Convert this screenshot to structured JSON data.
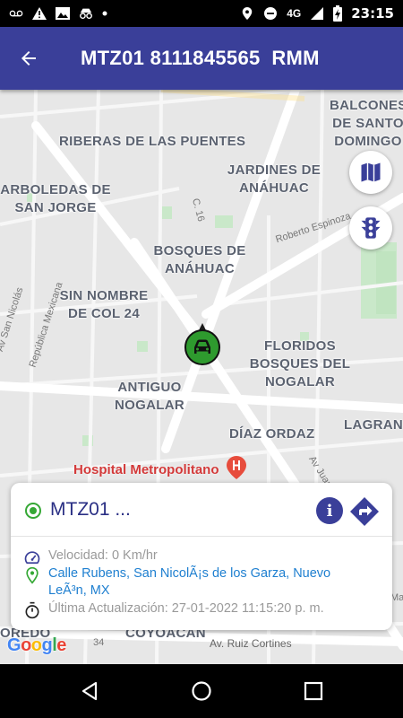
{
  "status_bar": {
    "time": "23:15",
    "network": "4G",
    "icons": [
      "voicemail-icon",
      "warning-icon",
      "image-icon",
      "incognito-icon",
      "dot-icon",
      "location-icon",
      "do-not-disturb-icon",
      "signal-icon",
      "battery-charging-icon"
    ]
  },
  "app_bar": {
    "title": "MTZ01 8111845565  RMM",
    "back_icon": "arrow-back-icon",
    "background": "#3a3f99"
  },
  "map": {
    "areas": [
      "RIBERAS DE LAS PUENTES",
      "ARBOLEDAS DE SAN JORGE",
      "JARDINES DE ANÁHUAC",
      "BOSQUES DE ANÁHUAC",
      "SIN NOMBRE DE COL 24",
      "FLORIDOS BOSQUES DEL NOGALAR",
      "ANTIGUO NOGALAR",
      "DÍAZ ORDAZ",
      "BALCONES DE SANTO DOMINGO",
      "LAGRAN",
      "OREDO",
      "COYOACÁN"
    ],
    "streets": [
      "Roberto Espinoza",
      "C. 16",
      "Av San Nicolás",
      "República Mexicana",
      "Av Juan",
      "Av. Ruiz Cortines",
      "34",
      "Ma"
    ],
    "poi": "Hospital Metropolitano",
    "poi_color": "#d33a3a",
    "buttons": {
      "map_layers_icon": "map-icon",
      "traffic_icon": "traffic-light-icon"
    },
    "vehicle_marker": {
      "icon": "car-icon",
      "color": "#2e9a2e"
    },
    "google_logo": "Google"
  },
  "vehicle_card": {
    "title": "MTZ01 ...",
    "status_color": "#35a835",
    "info_label": "i",
    "speed": "Velocidad: 0 Km/hr",
    "address": "Calle Rubens, San NicolÃ¡s de los Garza, Nuevo LeÃ³n, MX",
    "last_update": "Última Actualización: 27-01-2022 11:15:20 p. m."
  },
  "nav_bar": {
    "back_icon": "triangle-back-icon",
    "home_icon": "circle-home-icon",
    "recents_icon": "square-recents-icon"
  }
}
